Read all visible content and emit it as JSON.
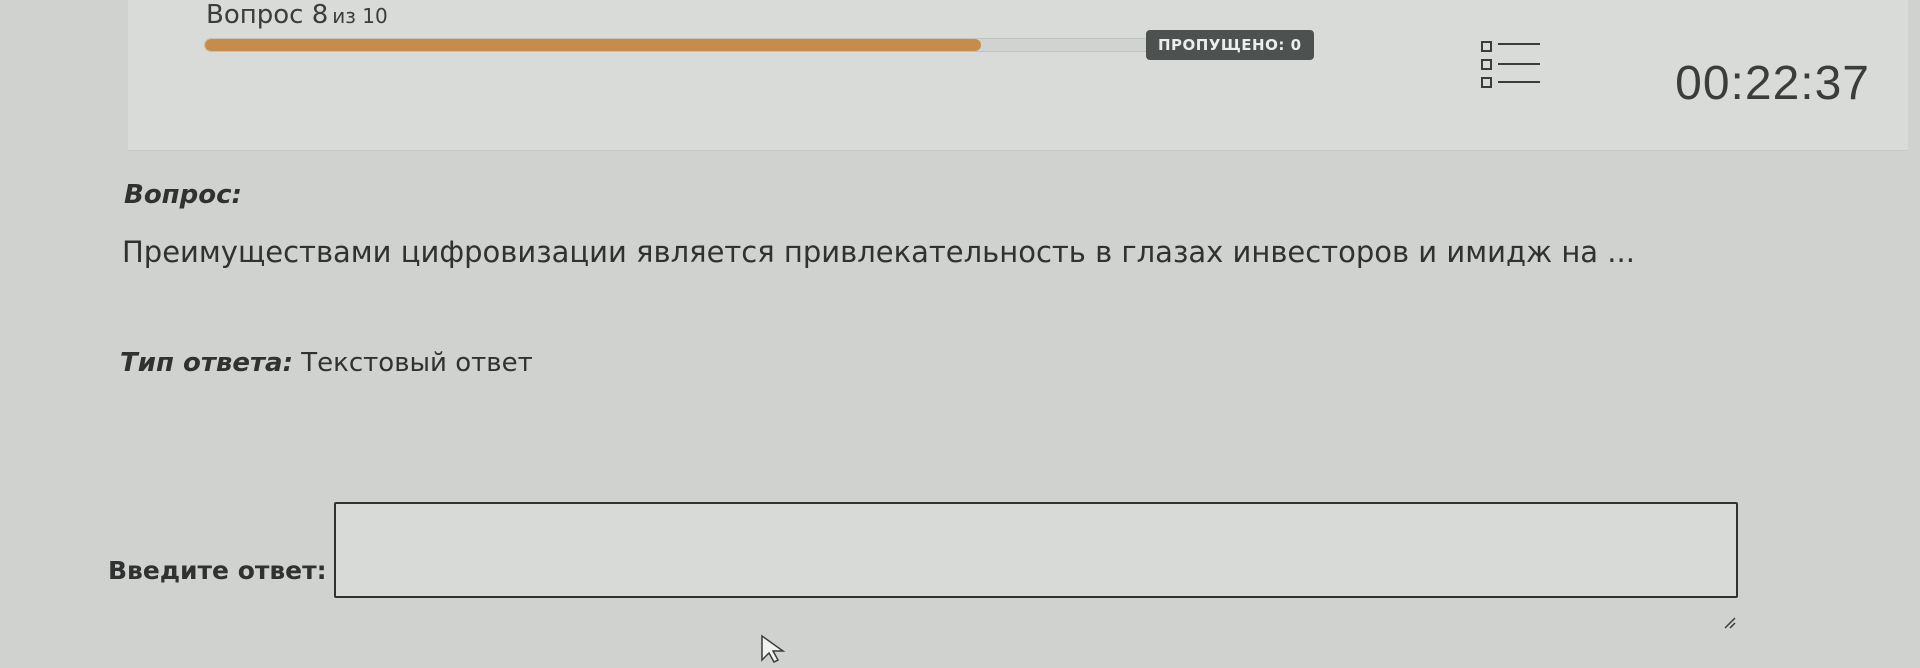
{
  "progress": {
    "question_label": "Вопрос 8",
    "of_total_label": "из 10",
    "current": 8,
    "total": 10,
    "fraction": 0.7
  },
  "skipped": {
    "label": "ПРОПУЩЕНО: 0"
  },
  "timer": {
    "value": "00:22:37"
  },
  "question": {
    "heading": "Вопрос:",
    "text": "Преимуществами цифровизации является привлекательность в глазах инвесторов и имидж на ..."
  },
  "answer_type": {
    "label": "Тип ответа:",
    "value": "Текстовый ответ"
  },
  "answer": {
    "label": "Введите ответ:",
    "value": "",
    "placeholder": ""
  },
  "icons": {
    "list": "question-list-icon",
    "resize": "resize-handle-icon",
    "cursor": "mouse-pointer-icon"
  },
  "colors": {
    "progress_fill": "#c78b4a",
    "badge_bg": "#4d5150",
    "background": "#cfd2cf"
  }
}
